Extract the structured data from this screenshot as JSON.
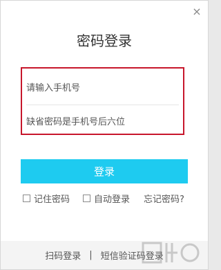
{
  "window": {
    "close_icon": "close-icon"
  },
  "title": "密码登录",
  "form": {
    "phone_placeholder": "请输入手机号",
    "password_placeholder": "缺省密码是手机号后六位"
  },
  "login_button": "登录",
  "options": {
    "remember": "记住密码",
    "auto_login": "自动登录",
    "forgot": "忘记密码?"
  },
  "footer": {
    "scan_login": "扫码登录",
    "separator": "|",
    "sms_login": "短信验证码登录"
  },
  "colors": {
    "accent": "#1ecbf0",
    "highlight_border": "#c7162b"
  }
}
